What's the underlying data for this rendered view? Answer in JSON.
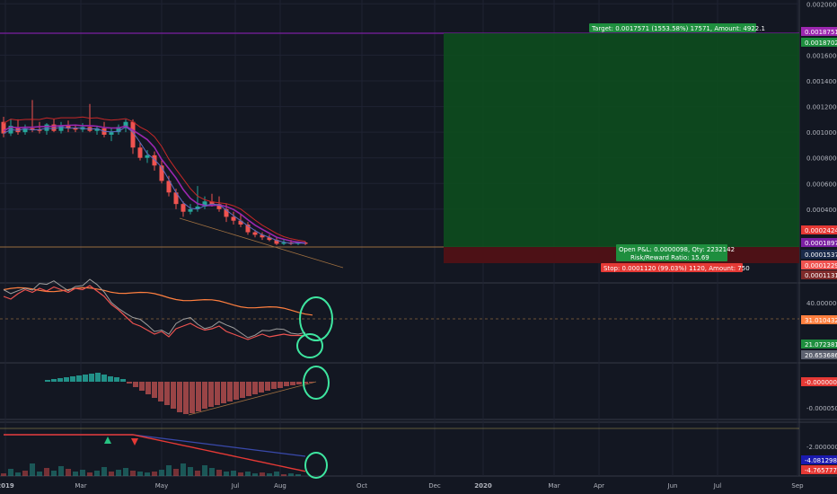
{
  "colors": {
    "bg": "#131722",
    "grid": "#1f2333",
    "text": "#b2b5be",
    "up": "#26a69a",
    "down": "#ef5350",
    "target_zone": "#0d4d1e",
    "stop_zone": "#4d1116",
    "target_label": "#1e8e3e",
    "stop_label": "#e53935",
    "ma_red": "#c62828",
    "ma_purple": "#9c27b0",
    "ma_blue": "#5c6bc0",
    "rsi_orange": "#ff7f3f",
    "osc_green": "#4caf50",
    "osc_gray": "#9e9e9e",
    "hist_pos": "#26a69a",
    "hist_neg": "#b14c4c",
    "circle": "#3ee6a0",
    "purple_line": "#7b1fa2"
  },
  "annotations": {
    "target": "Target: 0.0017571 (1553.58%) 17571, Amount: 4922.1",
    "open_pnl": "Open P&L: 0.0000098, Qty: 2232142",
    "risk_reward": "Risk/Reward Ratio: 15.69",
    "stop": "Stop: 0.0001120 (99.03%) 1120, Amount: 750"
  },
  "price_tags": [
    {
      "value": "0.0018751",
      "color": "#9c27b0"
    },
    {
      "value": "0.0018702",
      "color": "#1e8e3e"
    },
    {
      "value": "0.0002424",
      "color": "#e53935"
    },
    {
      "value": "0.0001897",
      "color": "#7b1fa2"
    },
    {
      "value": "0.0001537",
      "color": "#1a2a4a"
    },
    {
      "value": "0.0001229",
      "color": "#ef5350"
    },
    {
      "value": "0.0001131",
      "color": "#7e2a2a"
    }
  ],
  "panel2_tags": [
    {
      "value": "31.0104320",
      "color": "#ff7f3f"
    },
    {
      "value": "21.0723812",
      "color": "#1e8e3e"
    },
    {
      "value": "20.6536867",
      "color": "#5d6270"
    }
  ],
  "panel3_tags": [
    {
      "value": "-0.0000002",
      "color": "#e53935"
    }
  ],
  "panel4_tags": [
    {
      "value": "-4.0812980",
      "color": "#1a1ab0"
    },
    {
      "value": "-4.7657771",
      "color": "#e53935"
    }
  ],
  "chart_data": [
    {
      "type": "candlestick",
      "x_ticks": [
        "2019",
        "Mar",
        "May",
        "Jul",
        "Aug",
        "Oct",
        "Dec",
        "2020",
        "Mar",
        "Apr",
        "Jun",
        "Jul",
        "Sep"
      ],
      "y_ticks": [
        "0.0020000",
        "0.0016000",
        "0.0014000",
        "0.0012000",
        "0.0010000",
        "0.0008000",
        "0.0006000",
        "0.0004000"
      ],
      "ylim": [
        0.0,
        0.0021
      ],
      "candles": [
        {
          "o": 0.00108,
          "h": 0.00112,
          "l": 0.00096,
          "c": 0.00099
        },
        {
          "o": 0.00099,
          "h": 0.0011,
          "l": 0.00097,
          "c": 0.00105
        },
        {
          "o": 0.00104,
          "h": 0.0011,
          "l": 0.00098,
          "c": 0.001
        },
        {
          "o": 0.001,
          "h": 0.00106,
          "l": 0.00098,
          "c": 0.00103
        },
        {
          "o": 0.00103,
          "h": 0.00125,
          "l": 0.001,
          "c": 0.00102
        },
        {
          "o": 0.00102,
          "h": 0.00108,
          "l": 0.00099,
          "c": 0.00101
        },
        {
          "o": 0.00101,
          "h": 0.00107,
          "l": 0.00098,
          "c": 0.00106
        },
        {
          "o": 0.00106,
          "h": 0.0011,
          "l": 0.001,
          "c": 0.00101
        },
        {
          "o": 0.00101,
          "h": 0.00108,
          "l": 0.00099,
          "c": 0.00105
        },
        {
          "o": 0.00105,
          "h": 0.00109,
          "l": 0.001,
          "c": 0.00103
        },
        {
          "o": 0.00103,
          "h": 0.00106,
          "l": 0.001,
          "c": 0.00102
        },
        {
          "o": 0.00102,
          "h": 0.00107,
          "l": 0.001,
          "c": 0.00104
        },
        {
          "o": 0.00104,
          "h": 0.00122,
          "l": 0.001,
          "c": 0.00101
        },
        {
          "o": 0.00101,
          "h": 0.00105,
          "l": 0.00098,
          "c": 0.00103
        },
        {
          "o": 0.00103,
          "h": 0.00108,
          "l": 0.00096,
          "c": 0.00098
        },
        {
          "o": 0.00098,
          "h": 0.00103,
          "l": 0.00093,
          "c": 0.001
        },
        {
          "o": 0.001,
          "h": 0.00106,
          "l": 0.00098,
          "c": 0.00104
        },
        {
          "o": 0.00104,
          "h": 0.0011,
          "l": 0.001,
          "c": 0.00108
        },
        {
          "o": 0.00108,
          "h": 0.0011,
          "l": 0.00083,
          "c": 0.00088
        },
        {
          "o": 0.00088,
          "h": 0.00092,
          "l": 0.00078,
          "c": 0.0008
        },
        {
          "o": 0.0008,
          "h": 0.00086,
          "l": 0.00076,
          "c": 0.00082
        },
        {
          "o": 0.00082,
          "h": 0.00085,
          "l": 0.0007,
          "c": 0.00074
        },
        {
          "o": 0.00074,
          "h": 0.00078,
          "l": 0.0006,
          "c": 0.00062
        },
        {
          "o": 0.00062,
          "h": 0.00066,
          "l": 0.0005,
          "c": 0.00053
        },
        {
          "o": 0.00053,
          "h": 0.00056,
          "l": 0.0004,
          "c": 0.00044
        },
        {
          "o": 0.00044,
          "h": 0.00046,
          "l": 0.00034,
          "c": 0.00038
        },
        {
          "o": 0.00038,
          "h": 0.00044,
          "l": 0.00036,
          "c": 0.0004
        },
        {
          "o": 0.0004,
          "h": 0.00058,
          "l": 0.00038,
          "c": 0.00042
        },
        {
          "o": 0.00042,
          "h": 0.0005,
          "l": 0.0004,
          "c": 0.00046
        },
        {
          "o": 0.00046,
          "h": 0.00052,
          "l": 0.00042,
          "c": 0.00044
        },
        {
          "o": 0.00044,
          "h": 0.0005,
          "l": 0.00038,
          "c": 0.0004
        },
        {
          "o": 0.0004,
          "h": 0.00044,
          "l": 0.0003,
          "c": 0.00034
        },
        {
          "o": 0.00034,
          "h": 0.00038,
          "l": 0.00028,
          "c": 0.00031
        },
        {
          "o": 0.00031,
          "h": 0.00036,
          "l": 0.00026,
          "c": 0.00028
        },
        {
          "o": 0.00028,
          "h": 0.0003,
          "l": 0.0002,
          "c": 0.00022
        },
        {
          "o": 0.00022,
          "h": 0.00024,
          "l": 0.00018,
          "c": 0.0002
        },
        {
          "o": 0.0002,
          "h": 0.00022,
          "l": 0.00016,
          "c": 0.00018
        },
        {
          "o": 0.00018,
          "h": 0.0002,
          "l": 0.00015,
          "c": 0.00016
        },
        {
          "o": 0.00016,
          "h": 0.00018,
          "l": 0.00012,
          "c": 0.00013
        },
        {
          "o": 0.00013,
          "h": 0.00016,
          "l": 0.00012,
          "c": 0.00014
        },
        {
          "o": 0.00014,
          "h": 0.00016,
          "l": 0.00012,
          "c": 0.00013
        },
        {
          "o": 0.00013,
          "h": 0.00015,
          "l": 0.00012,
          "c": 0.00014
        },
        {
          "o": 0.00014,
          "h": 0.00015,
          "l": 0.00012,
          "c": 0.00013
        }
      ]
    }
  ]
}
